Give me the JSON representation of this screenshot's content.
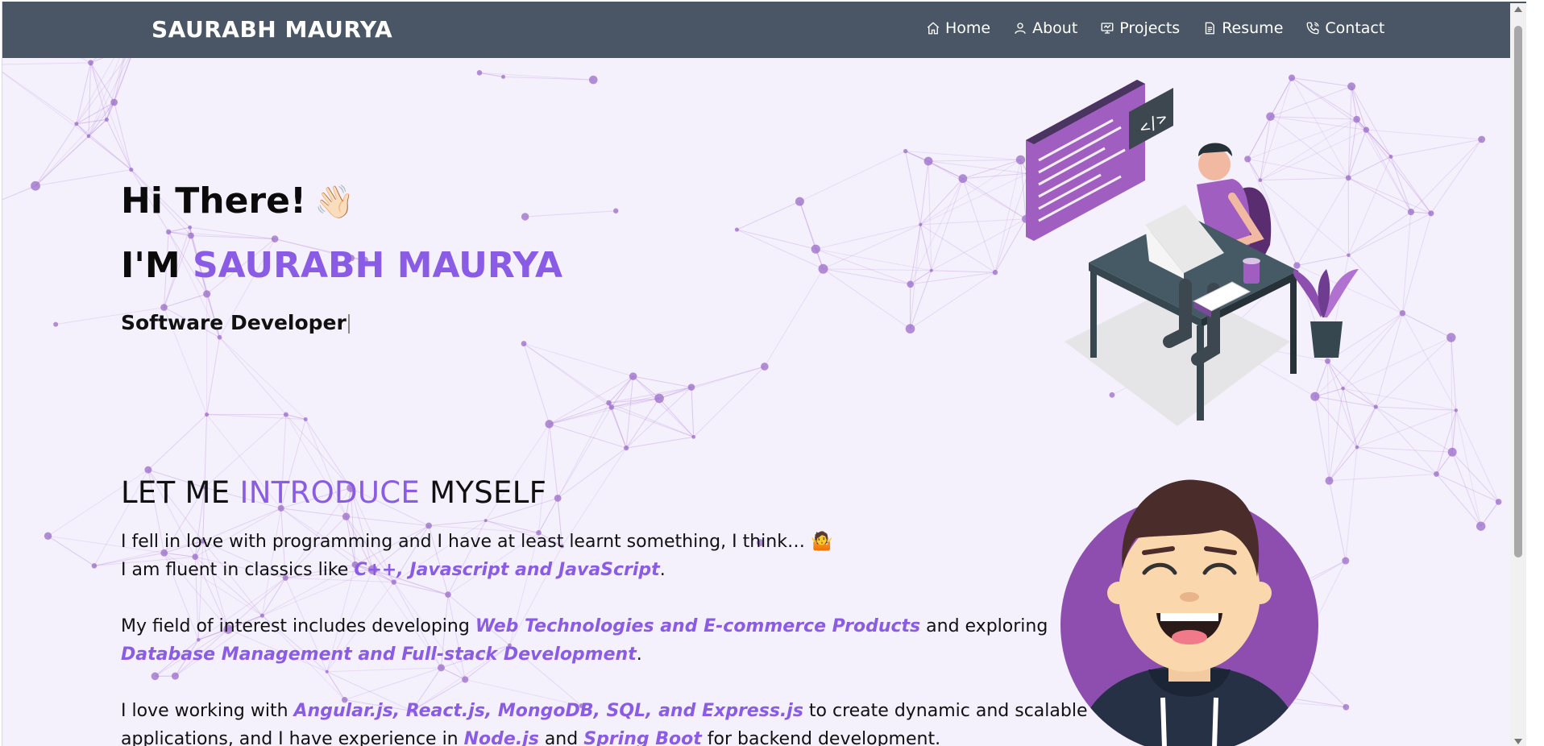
{
  "navbar": {
    "brand": "SAURABH MAURYA",
    "links": [
      {
        "label": "Home",
        "icon": "home-icon"
      },
      {
        "label": "About",
        "icon": "user-icon"
      },
      {
        "label": "Projects",
        "icon": "projects-icon"
      },
      {
        "label": "Resume",
        "icon": "document-icon"
      },
      {
        "label": "Contact",
        "icon": "phone-icon"
      }
    ]
  },
  "hero": {
    "greeting": "Hi There!",
    "wave_emoji": "👋🏻",
    "im_prefix": "I'M",
    "name": "SAURABH MAURYA",
    "role": "Software Developer"
  },
  "intro": {
    "title_part1": "LET ME",
    "title_accent": "INTRODUCE",
    "title_part2": "MYSELF",
    "line1": "I fell in love with programming and I have at least learnt something, I think… 🤷",
    "line2_prefix": "I am fluent in classics like ",
    "line2_highlight": "C++, Javascript and JavaScript",
    "line2_suffix": ".",
    "line3_prefix": "My field of interest includes developing ",
    "line3_highlight": "Web Technologies and E-commerce Products",
    "line3_suffix": " and exploring",
    "line4_highlight": "Database Management and Full-stack Development",
    "line4_suffix": ".",
    "line5_prefix": "I love working with ",
    "line5_highlight": "Angular.js, React.js, MongoDB, SQL, and Express.js",
    "line5_suffix": " to create dynamic and scalable",
    "line6_prefix": "applications, and I have experience in ",
    "line6_highlight1": "Node.js",
    "line6_mid": " and ",
    "line6_highlight2": "Spring Boot",
    "line6_suffix": " for backend development."
  },
  "colors": {
    "navbar_bg": "#4a5666",
    "accent": "#8a5ce6",
    "page_bg": "#f4f0fc",
    "avatar_circle": "#8e4eb0"
  }
}
